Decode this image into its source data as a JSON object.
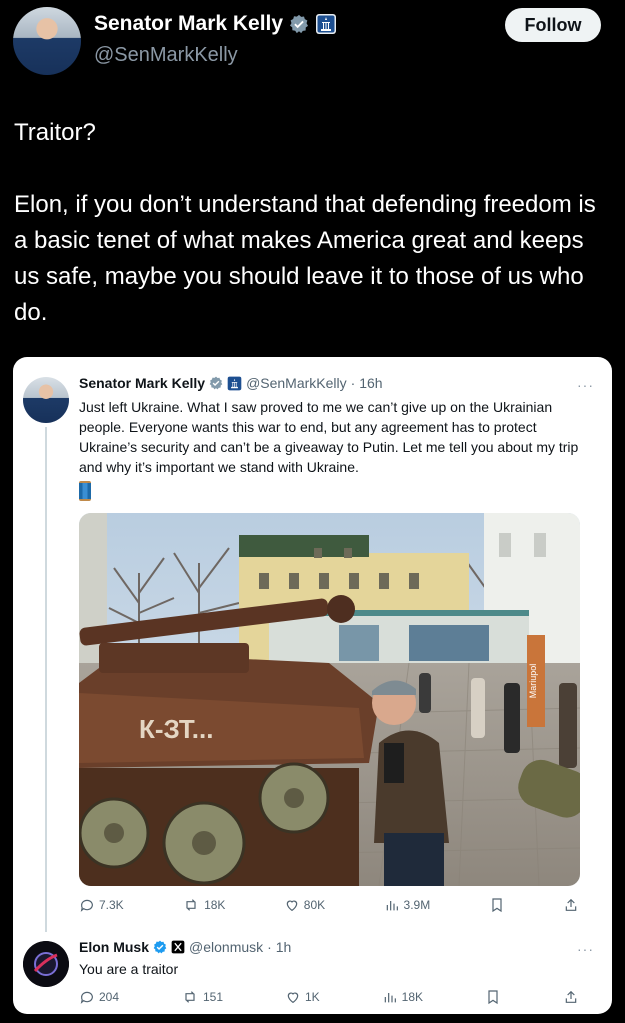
{
  "header": {
    "name": "Senator Mark Kelly",
    "handle": "@SenMarkKelly",
    "follow_label": "Follow"
  },
  "tweet": {
    "line1": "Traitor?",
    "line2": "Elon, if you don’t understand that defending freedom is a basic tenet of what makes America great and keeps us safe, maybe you should leave it to those of us who do."
  },
  "quoted": {
    "name": "Senator Mark Kelly",
    "handle": "@SenMarkKelly",
    "time": "· 16h",
    "more": "···",
    "text": "Just left Ukraine. What I saw proved to me we can’t give up on the Ukrainian people. Everyone wants this war to end, but any agreement has to protect Ukraine’s security and can’t be a giveaway to Putin. Let me tell you about my trip and why it’s important we stand with Ukraine.",
    "photo_sign": "Mariupol",
    "tank_graffiti": "К-ЗТ...",
    "metrics": {
      "replies": "7.3K",
      "reposts": "18K",
      "likes": "80K",
      "views": "3.9M"
    }
  },
  "reply": {
    "name": "Elon Musk",
    "handle": "@elonmusk",
    "time": "· 1h",
    "more": "···",
    "text": "You are a traitor",
    "metrics": {
      "replies": "204",
      "reposts": "151",
      "likes": "1K",
      "views": "18K"
    }
  },
  "colors": {
    "accent": "#1d9bf0",
    "verified_blue": "#1d9bf0",
    "gov_badge": "#829aab",
    "muted": "#536471"
  }
}
